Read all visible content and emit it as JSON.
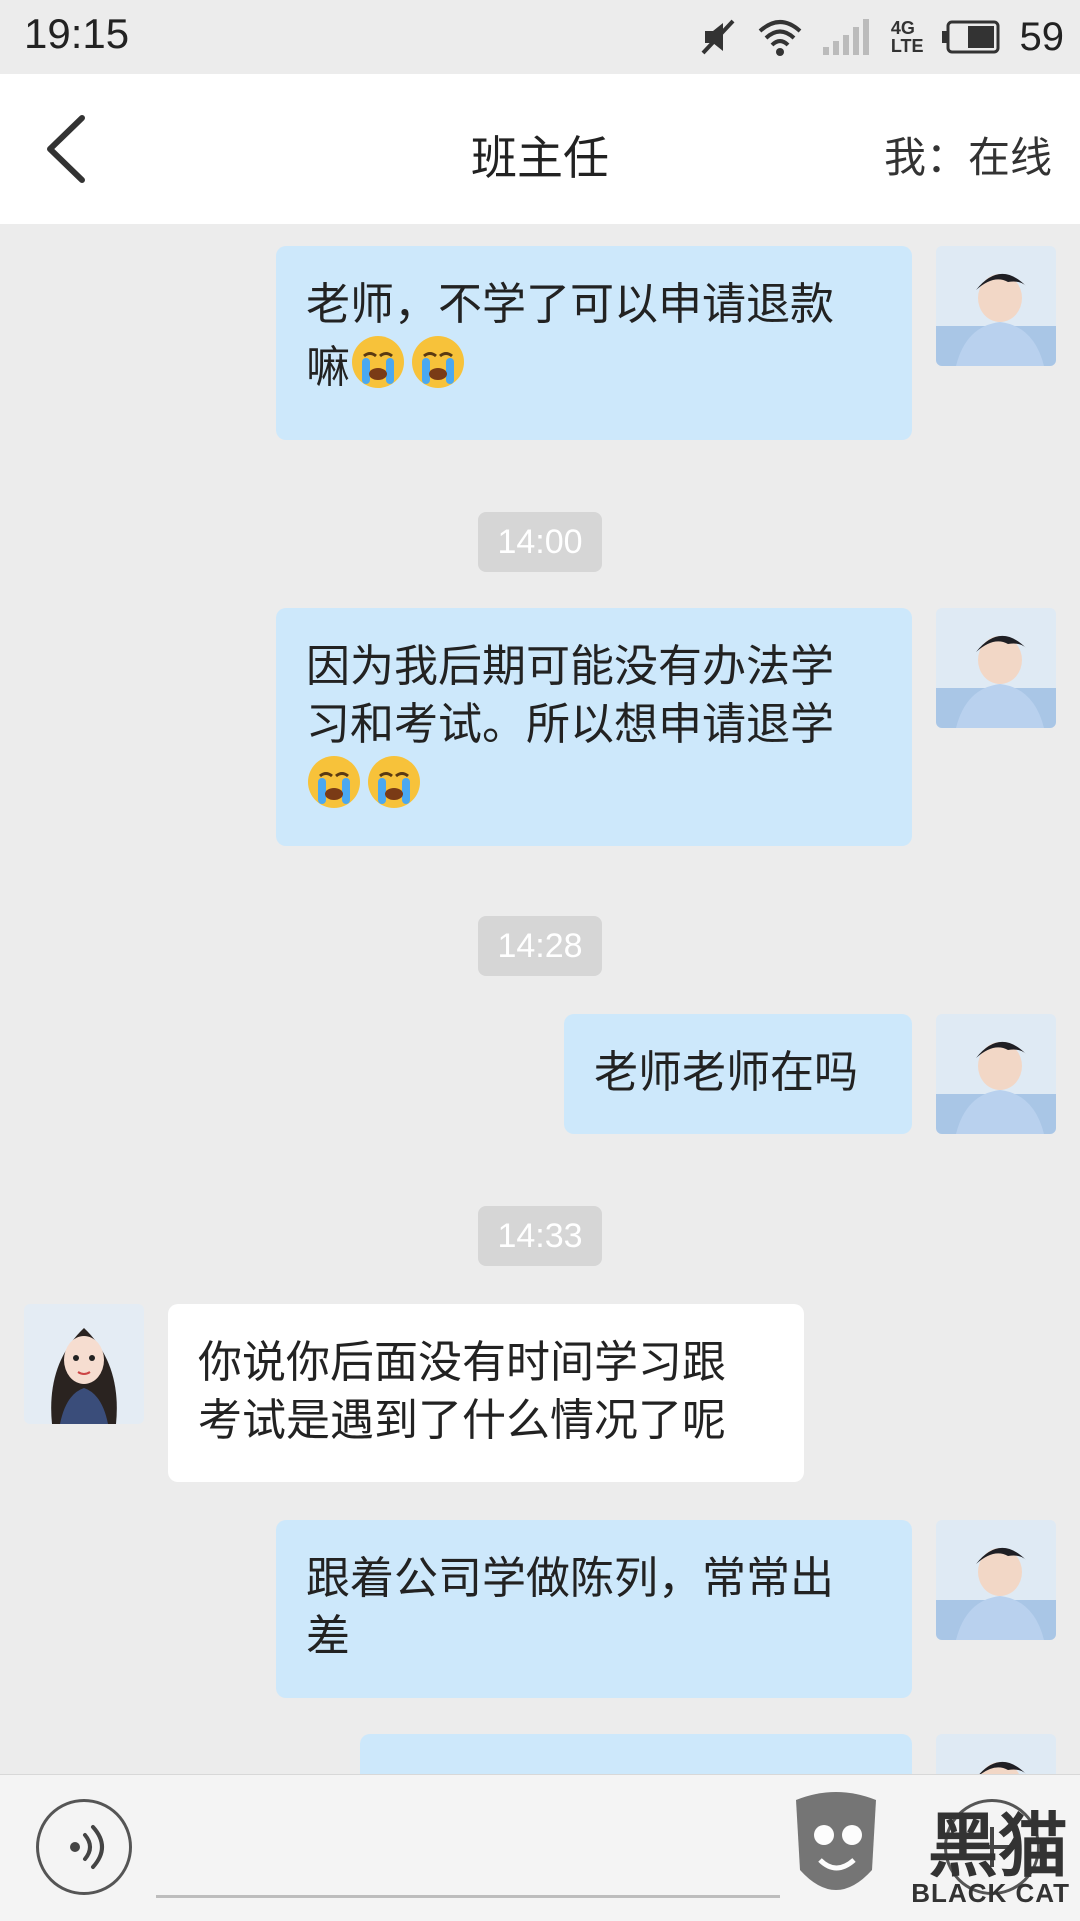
{
  "status_bar": {
    "time": "19:15",
    "network": "4G",
    "network_sub": "LTE",
    "battery": "59"
  },
  "header": {
    "title": "班主任",
    "status": "我：在线"
  },
  "messages": [
    {
      "from": "me",
      "text": "老师，不学了可以申请退款嘛",
      "emoji_count": 2
    },
    {
      "type": "time",
      "text": "14:00"
    },
    {
      "from": "me",
      "text": "因为我后期可能没有办法学习和考试。所以想申请退学",
      "emoji_count": 2
    },
    {
      "type": "time",
      "text": "14:28"
    },
    {
      "from": "me",
      "text": "老师老师在吗"
    },
    {
      "type": "time",
      "text": "14:33"
    },
    {
      "from": "them",
      "text": "你说你后面没有时间学习跟考试是遇到了什么情况了呢"
    },
    {
      "from": "me",
      "text": "跟着公司学做陈列，常常出差"
    }
  ],
  "msg_text": {
    "m1_l1": "老师，不学了可以申请退款",
    "m1_l2": "嘛",
    "m2_l1": "因为我后期可能没有办法学",
    "m2_l2": "习和考试。所以想申请退学",
    "m3": "老师老师在吗",
    "m4_l1": "你说你后面没有时间学习跟",
    "m4_l2": "考试是遇到了什么情况了呢",
    "m5_l1": "跟着公司学做陈列，常常出",
    "m5_l2": "差"
  },
  "times": {
    "t1": "14:00",
    "t2": "14:28",
    "t3": "14:33"
  },
  "watermark": {
    "text": "黑猫",
    "sub": "BLACK CAT"
  },
  "colors": {
    "my_bubble": "#cde8fb",
    "their_bubble": "#ffffff",
    "background": "#ececec"
  },
  "icons": [
    "back-chevron-icon",
    "mute-icon",
    "wifi-icon",
    "signal-icon",
    "battery-icon",
    "crying-emoji-icon",
    "voice-icon"
  ]
}
